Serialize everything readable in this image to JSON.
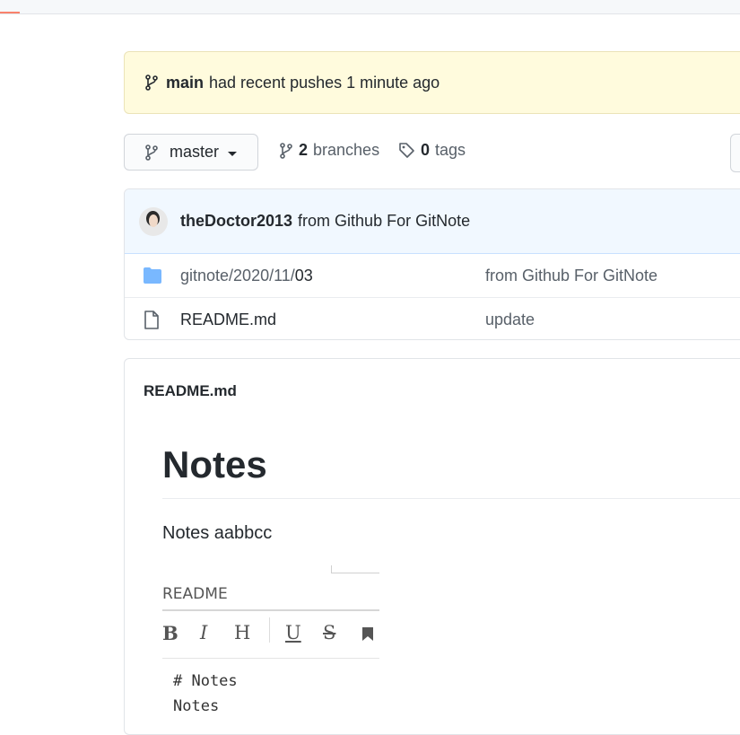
{
  "flash": {
    "branch": "main",
    "message": "had recent pushes 1 minute ago"
  },
  "branch_selector": {
    "label": "master"
  },
  "branches_link": {
    "count": "2",
    "label": "branches"
  },
  "tags_link": {
    "count": "0",
    "label": "tags"
  },
  "commit": {
    "author": "theDoctor2013",
    "message": "from Github For GitNote"
  },
  "files": [
    {
      "type": "directory",
      "icon": "folder-icon",
      "path_dim": "gitnote/2020/11/",
      "path_last": "03",
      "message": "from Github For GitNote"
    },
    {
      "type": "file",
      "icon": "file-icon",
      "path_dim": "",
      "path_last": "README.md",
      "message": "update"
    }
  ],
  "readme": {
    "title": "README.md",
    "heading": "Notes",
    "paragraph": "Notes aabbcc",
    "embedded": {
      "title": "README",
      "toolbar": [
        "B",
        "I",
        "H",
        "U",
        "S"
      ],
      "code_lines": [
        "# Notes",
        "Notes"
      ]
    }
  },
  "colors": {
    "accent": "#f9826c",
    "folder": "#79b8ff",
    "flash_bg": "#fffbdd",
    "commit_bg": "#f1f8ff"
  }
}
